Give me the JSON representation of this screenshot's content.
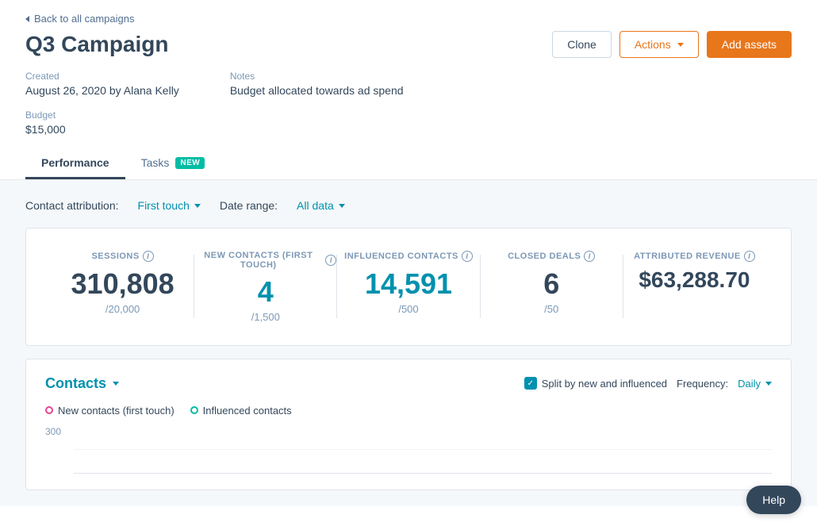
{
  "back_link": "Back to all campaigns",
  "campaign": {
    "title": "Q3 Campaign",
    "created_label": "Created",
    "created_value": "August 26, 2020 by Alana Kelly",
    "notes_label": "Notes",
    "notes_value": "Budget allocated towards ad spend",
    "budget_label": "Budget",
    "budget_value": "$15,000"
  },
  "buttons": {
    "clone": "Clone",
    "actions": "Actions",
    "add_assets": "Add assets"
  },
  "tabs": [
    {
      "id": "performance",
      "label": "Performance",
      "active": true,
      "badge": null
    },
    {
      "id": "tasks",
      "label": "Tasks",
      "active": false,
      "badge": "NEW"
    }
  ],
  "filters": {
    "contact_attribution_label": "Contact attribution:",
    "contact_attribution_value": "First touch",
    "date_range_label": "Date range:",
    "date_range_value": "All data"
  },
  "stats": [
    {
      "id": "sessions",
      "header": "SESSIONS",
      "value": "310,808",
      "sub": "/20,000",
      "teal": false
    },
    {
      "id": "new-contacts",
      "header": "NEW CONTACTS (FIRST TOUCH)",
      "value": "4",
      "sub": "/1,500",
      "teal": true
    },
    {
      "id": "influenced-contacts",
      "header": "INFLUENCED CONTACTS",
      "value": "14,591",
      "sub": "/500",
      "teal": true
    },
    {
      "id": "closed-deals",
      "header": "CLOSED DEALS",
      "value": "6",
      "sub": "/50",
      "teal": false
    },
    {
      "id": "attributed-revenue",
      "header": "ATTRIBUTED REVENUE",
      "value": "$63,288.70",
      "sub": "",
      "teal": false,
      "revenue": true
    }
  ],
  "contacts_section": {
    "title": "Contacts",
    "split_label": "Split by new and influenced",
    "frequency_label": "Frequency:",
    "frequency_value": "Daily",
    "legend": [
      {
        "id": "new-contacts",
        "label": "New contacts (first touch)",
        "color": "pink"
      },
      {
        "id": "influenced-contacts",
        "label": "Influenced contacts",
        "color": "teal"
      }
    ],
    "chart_yaxis": "300"
  },
  "help_button": "Help"
}
